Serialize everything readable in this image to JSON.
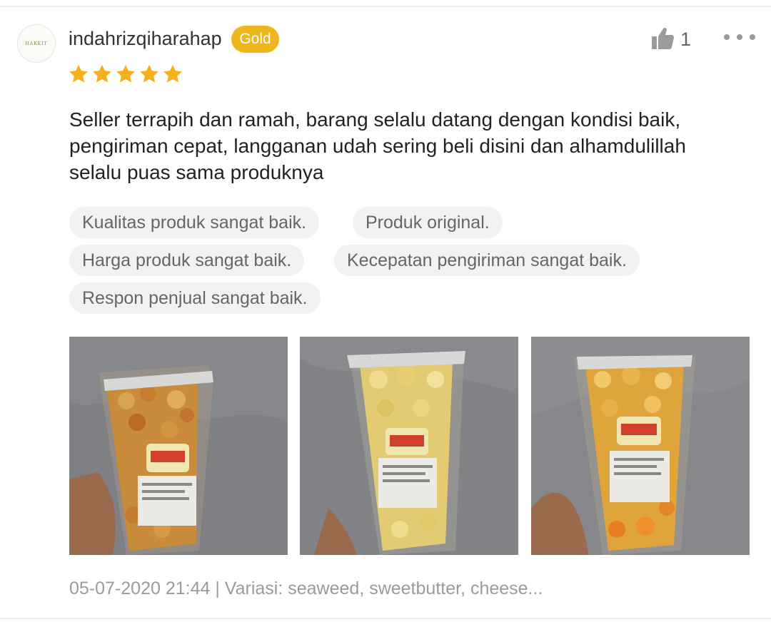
{
  "review": {
    "username": "indahrizqiharahap",
    "badge": "Gold",
    "avatar_text": "HAKKIT",
    "like_count": "1",
    "rating": 5,
    "text": "Seller terrapih dan ramah, barang selalu datang dengan kondisi baik, pengiriman cepat, langganan udah sering beli disini dan alhamdulillah selalu puas sama produknya",
    "tags": [
      "Kualitas produk sangat baik.",
      "Produk original.",
      "Harga produk sangat baik.",
      "Kecepatan pengiriman sangat baik.",
      "Respon penjual sangat baik."
    ],
    "meta": "05-07-2020 21:44 | Variasi: seaweed, sweetbutter, cheese..."
  },
  "icons": {
    "like": "thumbs-up-icon",
    "more": "more-options-icon",
    "star": "star-icon"
  },
  "colors": {
    "badge": "#efb51d",
    "star": "#f6b019",
    "tag_bg": "#f2f2f2",
    "text": "#222222",
    "muted": "#9b9b9b"
  }
}
